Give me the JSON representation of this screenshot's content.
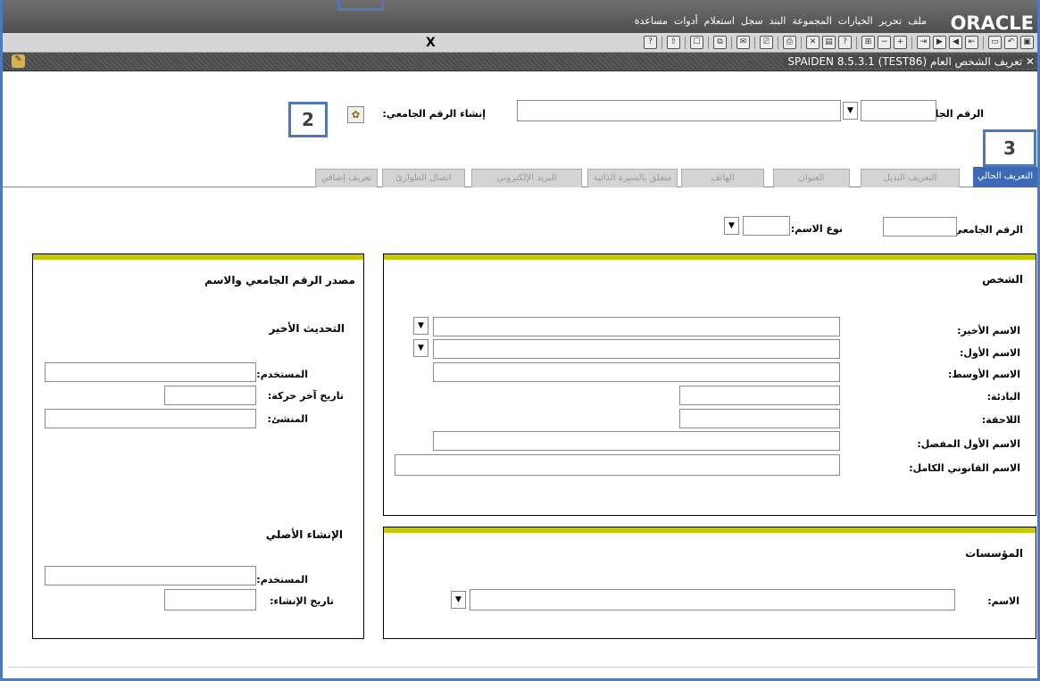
{
  "menubar": {
    "logo": "ORACLE",
    "items": [
      "ملف",
      "تحرير",
      "الخيارات",
      "المجموعة",
      "البند",
      "سجل",
      "استعلام",
      "أدوات",
      "مساعدة"
    ]
  },
  "toolbar": {
    "exit_label": "X",
    "icons": [
      "save-icon",
      "rollback-icon",
      "print-preview-icon",
      "sep",
      "first-record-icon",
      "previous-record-icon",
      "next-record-icon",
      "last-record-icon",
      "sep",
      "insert-record-icon",
      "remove-record-icon",
      "lock-record-icon",
      "sep",
      "enter-query-icon",
      "execute-query-icon",
      "cancel-query-icon",
      "sep",
      "export-icon",
      "sep",
      "print-icon",
      "sep",
      "extract-icon",
      "sep",
      "related-icon",
      "sep",
      "block-icon",
      "sep",
      "previous-block-icon",
      "sep",
      "help-icon"
    ]
  },
  "titlebar": {
    "close": "✕",
    "title": "تعريف الشخص العام  SPAIDEN 8.5.3.1 (TEST86)"
  },
  "key_block": {
    "id_label": "الرقم الجامعي:",
    "id_value": "",
    "name_value": "",
    "generate_id_label": "إنشاء الرقم الجامعي:"
  },
  "callouts": {
    "two": "2",
    "three": "3"
  },
  "tabs": [
    {
      "label": "التعريف الحالي",
      "active": true
    },
    {
      "label": "التعريف البديل",
      "active": false
    },
    {
      "label": "العنوان",
      "active": false
    },
    {
      "label": "الهاتف",
      "active": false
    },
    {
      "label": "متعلق بالسيرة الذاتية",
      "active": false
    },
    {
      "label": "البريد الإلكتروني",
      "active": false
    },
    {
      "label": "اتصال الطوارئ",
      "active": false
    },
    {
      "label": "تعريف إضافي",
      "active": false
    }
  ],
  "current_id": {
    "id_label": "الرقم الجامعي:",
    "name_type_label": "نوع الاسم:"
  },
  "person": {
    "title": "الشخص",
    "last_name": "الاسم الأخير:",
    "first_name": "الاسم الأول:",
    "middle_name": "الاسم الأوسط:",
    "prefix": "البادئة:",
    "suffix": "اللاحقة:",
    "preferred_first": "الاسم الأول المفضل:",
    "full_legal": "الاسم القانوني الكامل:"
  },
  "institutions": {
    "title": "المؤسسات",
    "name": "الاسم:"
  },
  "source": {
    "title": "مصدر الرقم الجامعي والاسم",
    "last_update": "التحديث الأخير",
    "user": "المستخدم:",
    "activity_date": "تاريخ آخر حركة:",
    "origin": "المنشئ:",
    "original_creation": "الإنشاء الأصلي",
    "created_user": "المستخدم:",
    "create_date": "تاريخ الإنشاء:"
  }
}
